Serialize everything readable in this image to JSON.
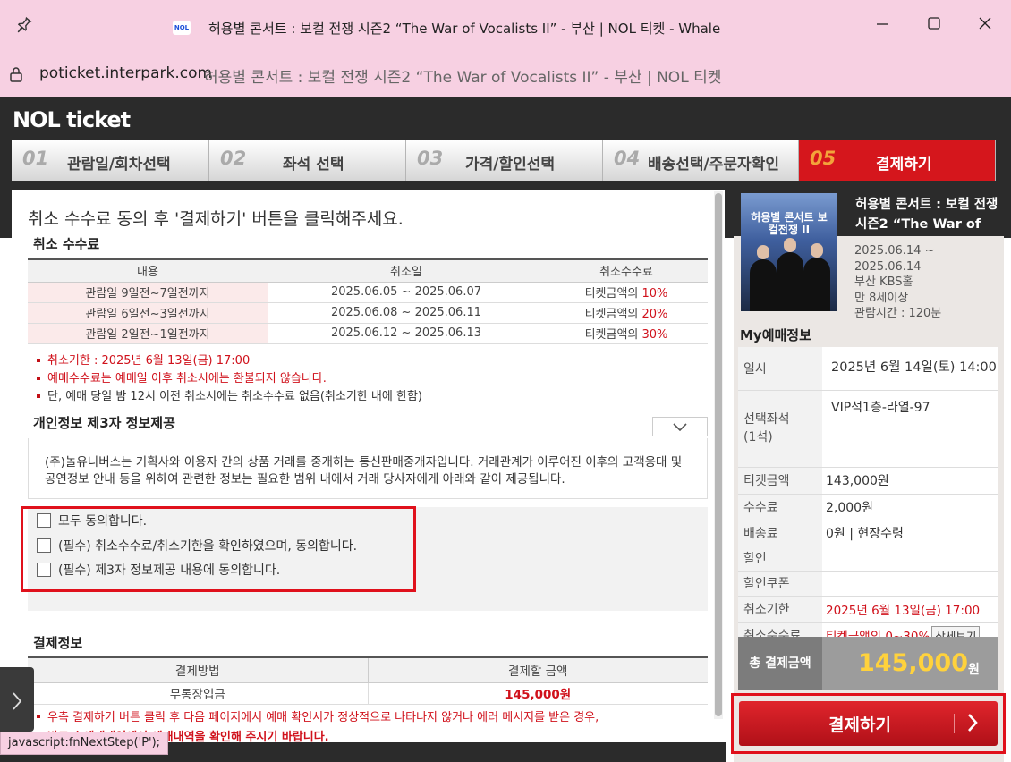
{
  "browser": {
    "window_title": "허용별 콘서트 : 보컬 전쟁 시즌2 “The War of Vocalists II” - 부산 | NOL 티켓 - Whale",
    "favicon_text": "NOL",
    "url_domain": "poticket.interpark.com",
    "url_title": "허용별 콘서트 : 보컬 전쟁 시즌2 “The War of Vocalists II” - 부산 | NOL 티켓",
    "status_tip": "javascript:fnNextStep('P');"
  },
  "header": {
    "logo": "NOL ticket",
    "steps": [
      {
        "num": "01",
        "label": "관람일/회차선택"
      },
      {
        "num": "02",
        "label": "좌석 선택"
      },
      {
        "num": "03",
        "label": "가격/할인선택"
      },
      {
        "num": "04",
        "label": "배송선택/주문자확인"
      },
      {
        "num": "05",
        "label": "결제하기"
      }
    ]
  },
  "main": {
    "instruction": "취소 수수료 동의 후 '결제하기' 버튼을 클릭해주세요.",
    "fee_section_title": "취소 수수료",
    "fee_table": {
      "headers": [
        "내용",
        "취소일",
        "취소수수료"
      ],
      "rows": [
        {
          "content": "관람일 9일전~7일전까지",
          "date": "2025.06.05 ~ 2025.06.07",
          "fee_prefix": "티켓금액의 ",
          "fee_rate": "10%"
        },
        {
          "content": "관람일 6일전~3일전까지",
          "date": "2025.06.08 ~ 2025.06.11",
          "fee_prefix": "티켓금액의 ",
          "fee_rate": "20%"
        },
        {
          "content": "관람일 2일전~1일전까지",
          "date": "2025.06.12 ~ 2025.06.13",
          "fee_prefix": "티켓금액의 ",
          "fee_rate": "30%"
        }
      ]
    },
    "notes": [
      "취소기한 : 2025년 6월 13일(금) 17:00",
      "예매수수료는 예매일 이후 취소시에는 환불되지 않습니다.",
      "단, 예매 당일 밤 12시 이전 취소시에는 취소수수료 없음(취소기한 내에 한함)"
    ],
    "privacy_section_title": "개인정보 제3자 정보제공",
    "privacy_text": "(주)놀유니버스는 기획사와 이용자 간의 상품 거래를 중개하는 통신판매중개자입니다. 거래관계가 이루어진 이후의 고객응대 및 공연정보 안내 등을 위하여 관련한 정보는 필요한 범위 내에서 거래 당사자에게 아래와 같이 제공됩니다.",
    "agreements": [
      "모두 동의합니다.",
      "(필수) 취소수수료/취소기한을 확인하였으며, 동의합니다.",
      "(필수) 제3자 정보제공 내용에 동의합니다."
    ],
    "payment_section_title": "결제정보",
    "payment_table": {
      "headers": [
        "결제방법",
        "결제할 금액"
      ],
      "method": "무통장입금",
      "amount": "145,000원"
    },
    "payment_notice": [
      "우측 결제하기 버튼 클릭 후 다음 페이지에서 예매 확인서가 정상적으로 나타나지 않거나 에러 메시지를 받은 경우,",
      "반드시 예매내역에서 예매내역을 확인해 주시기 바랍니다."
    ]
  },
  "sidebar": {
    "poster_text": "허용별 콘서트 보컬전쟁 II",
    "concert_title": "허용별 콘서트 : 보컬 전쟁 시즌2 “The War of",
    "info_lines": [
      "2025.06.14 ~",
      "2025.06.14",
      "부산 KBS홀",
      "만 8세이상",
      "관람시간 : 120분"
    ],
    "my_title": "My예매정보",
    "rows": [
      {
        "label": "일시",
        "value": "2025년 6월 14일(토) 14:00"
      },
      {
        "label": "선택좌석\n(1석)",
        "value": "VIP석1층-라열-97"
      },
      {
        "label": "티켓금액",
        "value": "143,000원"
      },
      {
        "label": "수수료",
        "value": "2,000원"
      },
      {
        "label": "배송료",
        "value": "0원 | 현장수령"
      },
      {
        "label": "할인",
        "value": ""
      },
      {
        "label": "할인쿠폰",
        "value": ""
      },
      {
        "label": "취소기한",
        "value": "2025년 6월 13일(금) 17:00"
      },
      {
        "label": "취소수수료",
        "value": "티켓금액의 0~30%"
      }
    ],
    "detail_button": "상세보기",
    "total_label": "총 결제금액",
    "total_amount": "145,000",
    "total_unit": "원",
    "pay_button": "결제하기"
  },
  "colors": {
    "accent_red": "#d5161c",
    "title_bar": "#f7d0e2",
    "total_amount": "#ffd23c"
  },
  "icons": {
    "pin": "pin-icon",
    "lock": "lock-icon",
    "minimize": "minimize-icon",
    "maximize": "maximize-icon",
    "close": "close-icon",
    "chevron": "chevron-down-icon",
    "arrow": "chevron-right-icon"
  }
}
